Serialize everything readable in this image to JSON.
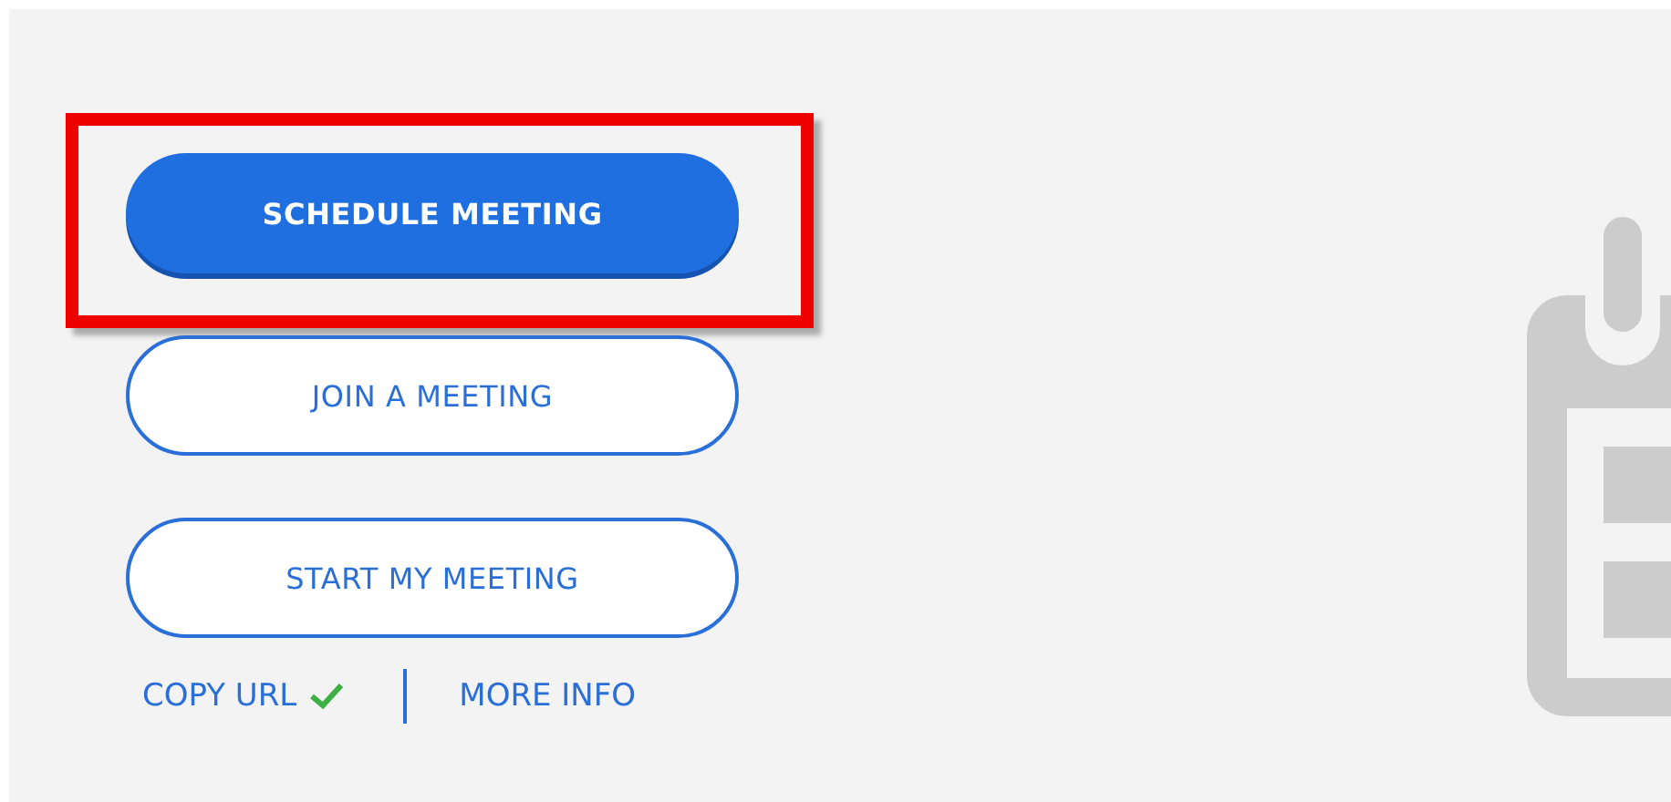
{
  "actions": [
    {
      "label": "SCHEDULE MEETING",
      "kind": "primary",
      "highlighted": true
    },
    {
      "label": "JOIN A MEETING",
      "kind": "outline",
      "highlighted": false
    },
    {
      "label": "START MY MEETING",
      "kind": "outline",
      "highlighted": false
    }
  ],
  "links": [
    {
      "label": "COPY URL",
      "copied": true
    },
    {
      "label": "MORE INFO",
      "copied": false
    }
  ]
}
